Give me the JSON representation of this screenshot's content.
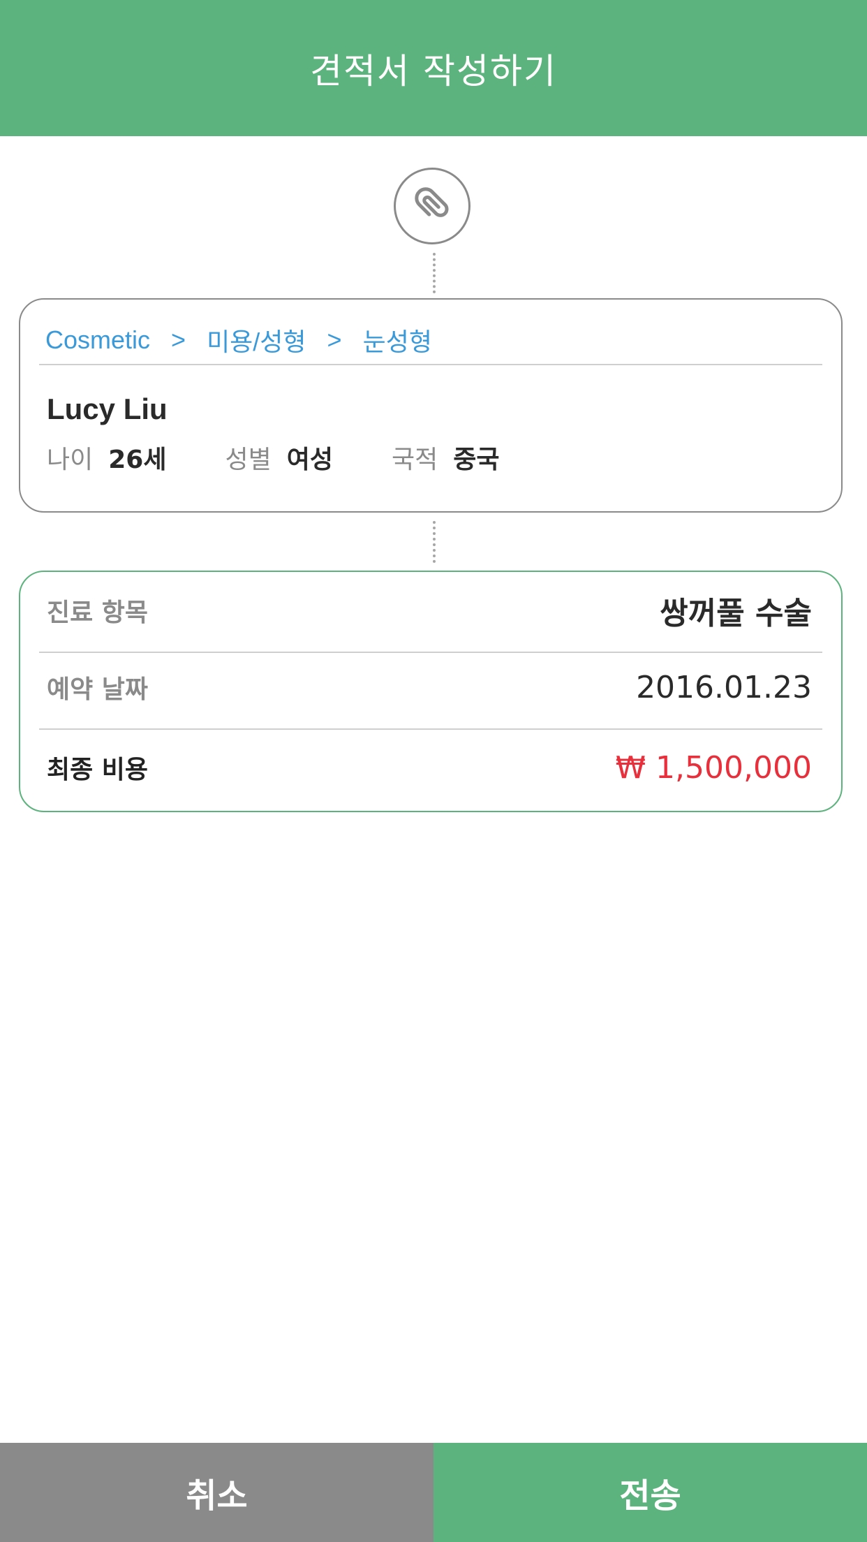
{
  "header": {
    "title": "견적서 작성하기"
  },
  "icons": {
    "attachment": "paperclip-icon"
  },
  "patient": {
    "breadcrumb": [
      "Cosmetic",
      "미용/성형",
      "눈성형"
    ],
    "breadcrumb_separator": ">",
    "name": "Lucy Liu",
    "age_label": "나이",
    "age_value": "26세",
    "gender_label": "성별",
    "gender_value": "여성",
    "nationality_label": "국적",
    "nationality_value": "중국"
  },
  "quote": {
    "treatment_label": "진료 항목",
    "treatment_value": "쌍꺼풀 수술",
    "date_label": "예약 날짜",
    "date_value": "2016.01.23",
    "cost_label": "최종 비용",
    "cost_value": "₩ 1,500,000"
  },
  "buttons": {
    "cancel": "취소",
    "send": "전송"
  },
  "colors": {
    "brand_green": "#5db37d",
    "link_blue": "#3a9ad9",
    "price_red": "#e8303c",
    "cancel_gray": "#8a8a8a"
  }
}
